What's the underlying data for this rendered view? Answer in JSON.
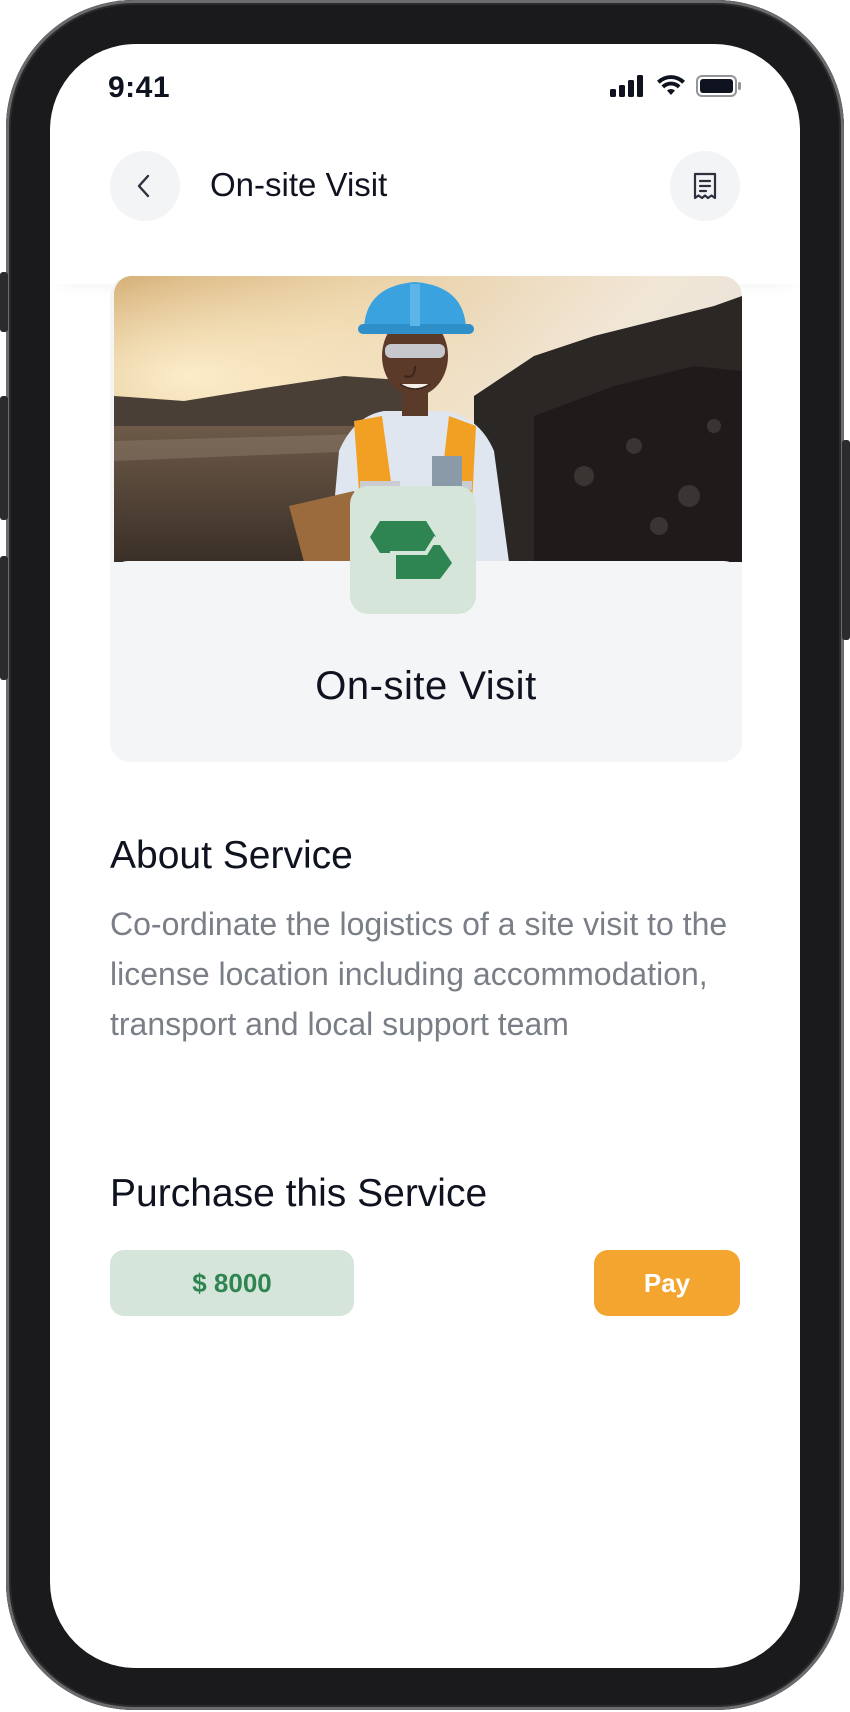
{
  "status_bar": {
    "time": "9:41"
  },
  "header": {
    "title": "On-site Visit",
    "back_icon": "chevron-left-icon",
    "action_icon": "receipt-icon"
  },
  "hero": {
    "title": "On-site Visit",
    "image": "site-worker-photo",
    "badge_icon": "service-tag-icon"
  },
  "about": {
    "heading": "About Service",
    "description": "Co-ordinate the logistics of a site visit to the license location including accommodation, transport and local support team"
  },
  "purchase": {
    "heading": "Purchase this Service",
    "price": "$ 8000",
    "pay_label": "Pay"
  },
  "colors": {
    "accent_green": "#2f8552",
    "green_tint": "#d6e5da",
    "pay_orange": "#f3a52f",
    "text_dark": "#0f1320",
    "text_muted": "#7a7f87"
  }
}
